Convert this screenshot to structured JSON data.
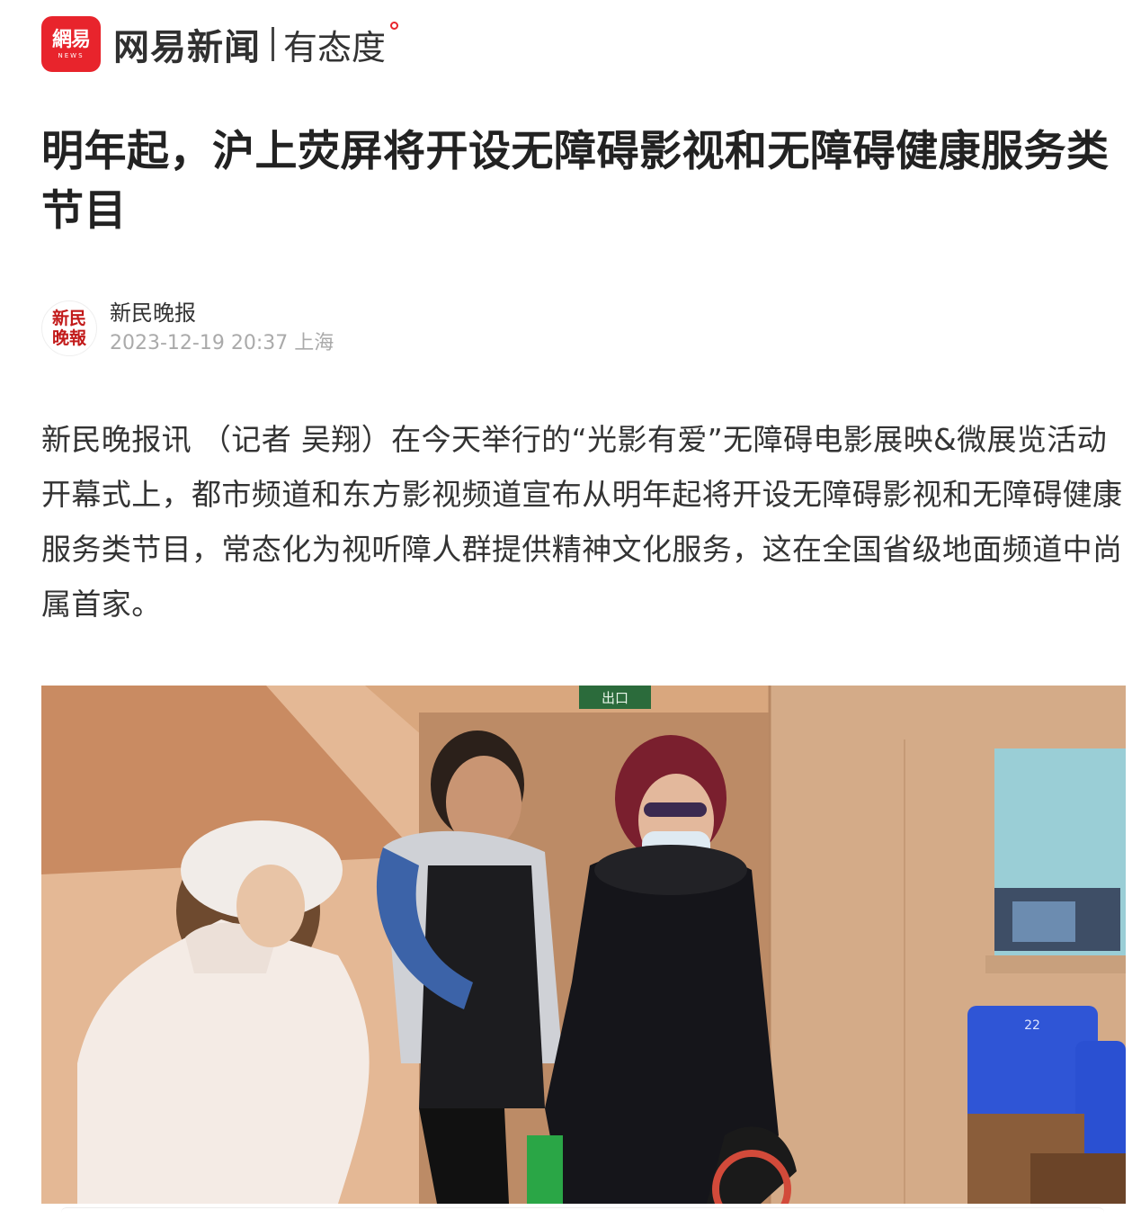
{
  "header": {
    "logo_cn": "網易",
    "logo_en": "NEWS",
    "brand": "网易新闻",
    "slogan": "有态度",
    "brand_color": "#e8242c"
  },
  "article": {
    "title": "明年起，沪上荧屏将开设无障碍影视和无障碍健康服务类节目",
    "source": {
      "avatar_text": "新民晚報",
      "name": "新民晚报",
      "datetime": "2023-12-19 20:37 上海"
    },
    "paragraph": "新民晚报讯 （记者 吴翔）在今天举行的“光影有爱”无障碍电影展映&微展览活动开幕式上，都市频道和东方影视频道宣布从明年起将开设无障碍影视和无障碍健康服务类节目，常态化为视听障人群提供精神文化服务，这在全国省级地面频道中尚属首家。",
    "photo": {
      "exit_sign": "出口",
      "seat_number": "22"
    }
  }
}
